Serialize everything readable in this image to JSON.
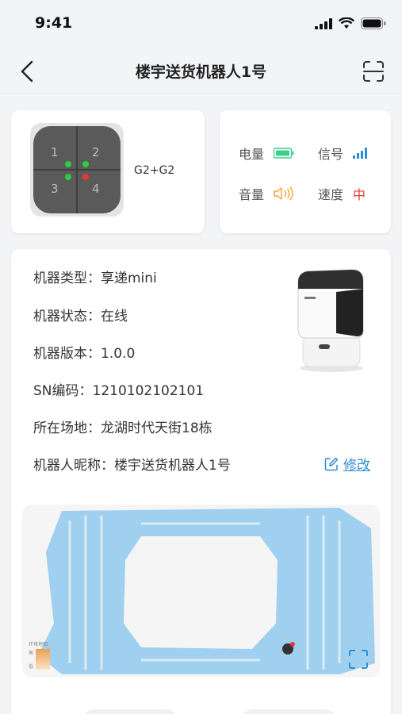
{
  "status_bar": {
    "time": "9:41"
  },
  "nav": {
    "title": "楼宇送货机器人1号"
  },
  "keypad": {
    "buttons": [
      "1",
      "2",
      "3",
      "4"
    ],
    "label": "G2+G2",
    "colors": {
      "green": "#2ecc40",
      "red": "#e53935"
    }
  },
  "status": {
    "battery_label": "电量",
    "signal_label": "信号",
    "volume_label": "音量",
    "speed_label": "速度",
    "speed_value": "中"
  },
  "info": {
    "type": "机器类型：享递mini",
    "state": "机器状态：在线",
    "version": "机器版本：1.0.0",
    "sn": "SN编码：1210102102101",
    "site": "所在场地：龙湖时代天街18栋",
    "nickname": "机器人昵称：楼宇送货机器人1号",
    "edit_label": "修改"
  },
  "map": {
    "legend_title": "环境地图",
    "legend_high": "高",
    "legend_low": "低"
  },
  "colors": {
    "accent": "#2a8fd0",
    "map_blue": "#9fd0ef",
    "battery": "#3ecf8e",
    "volume": "#f0a030",
    "speed": "#e53935"
  }
}
